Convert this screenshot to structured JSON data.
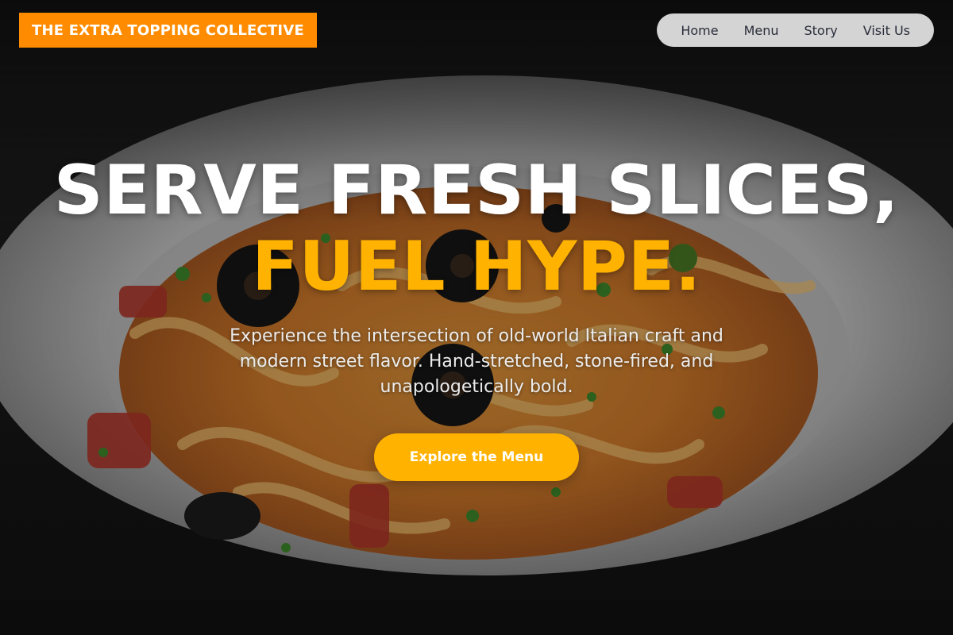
{
  "brand": {
    "name": "THE EXTRA TOPPING COLLECTIVE"
  },
  "nav": {
    "items": [
      {
        "label": "Home"
      },
      {
        "label": "Menu"
      },
      {
        "label": "Story"
      },
      {
        "label": "Visit Us"
      }
    ]
  },
  "hero": {
    "headline_line1": "SERVE FRESH SLICES,",
    "headline_line2": "FUEL HYPE.",
    "subtext": "Experience the intersection of old-world Italian craft and modern street flavor. Hand-stretched, stone-fired, and unapologetically bold.",
    "cta_label": "Explore the Menu",
    "background_image": "plate-of-pasta-with-olives-photo"
  },
  "colors": {
    "brand_orange": "#ff8c00",
    "accent_yellow": "#ffb300",
    "nav_bg": "#e4e4e4",
    "nav_text": "#2a2d3a",
    "headline_white": "#ffffff"
  }
}
